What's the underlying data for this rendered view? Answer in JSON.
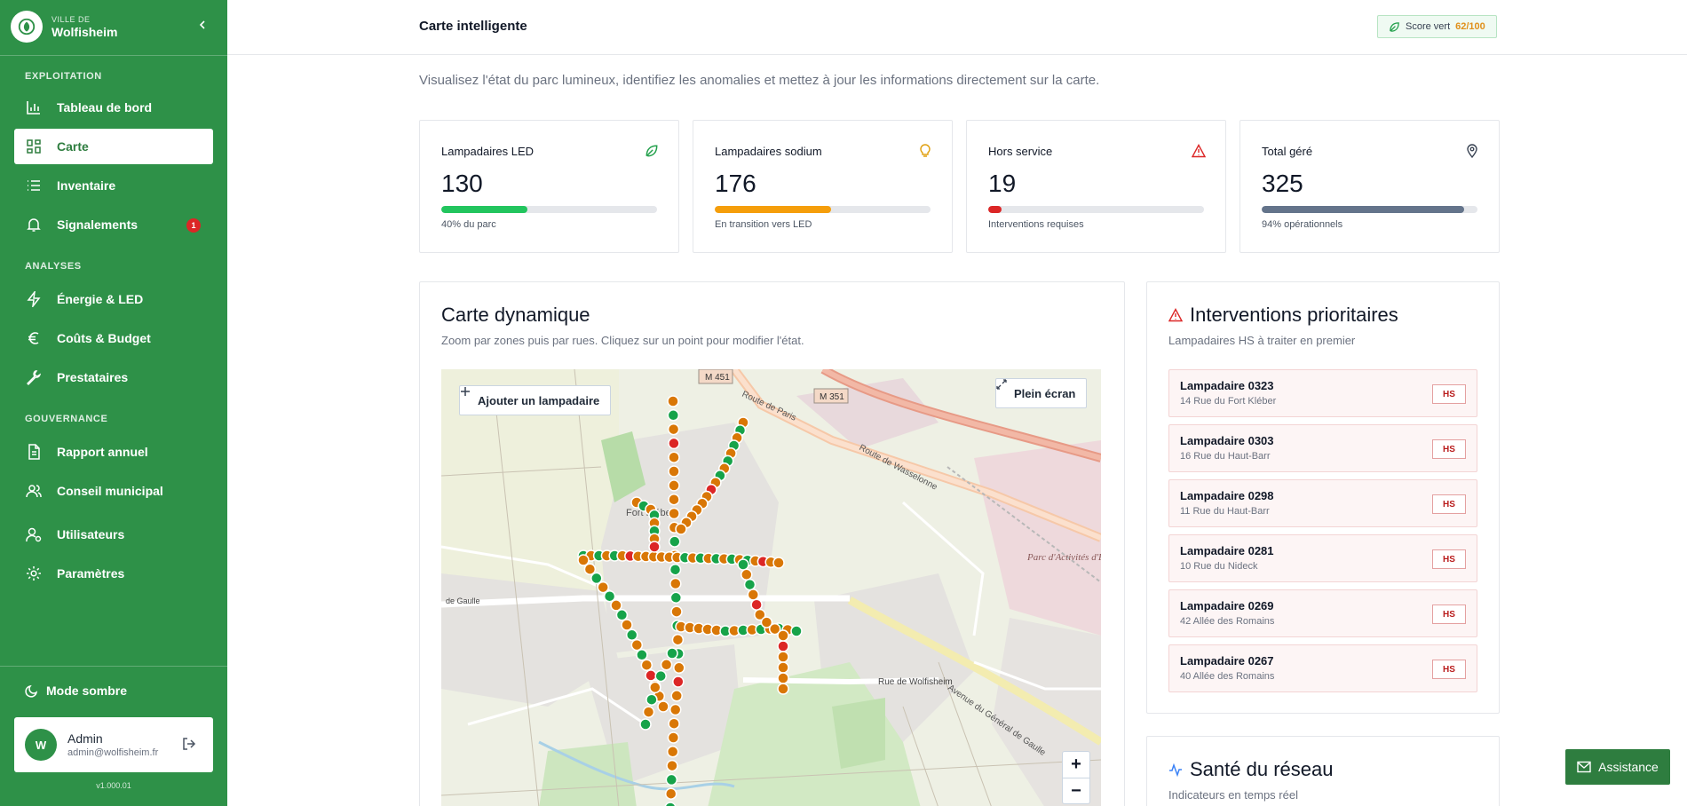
{
  "brand": {
    "sub": "VILLE DE",
    "name": "Wolfisheim"
  },
  "sidebar": {
    "sections": [
      "EXPLOITATION",
      "ANALYSES",
      "GOUVERNANCE"
    ],
    "items": [
      {
        "label": "Tableau de bord",
        "icon": "bar-chart-icon"
      },
      {
        "label": "Carte",
        "icon": "grid-icon"
      },
      {
        "label": "Inventaire",
        "icon": "list-icon"
      },
      {
        "label": "Signalements",
        "icon": "bell-icon",
        "badge": "1"
      },
      {
        "label": "Énergie & LED",
        "icon": "zap-icon"
      },
      {
        "label": "Coûts & Budget",
        "icon": "euro-icon"
      },
      {
        "label": "Prestataires",
        "icon": "wrench-icon"
      },
      {
        "label": "Rapport annuel",
        "icon": "file-icon"
      },
      {
        "label": "Conseil municipal",
        "icon": "users-icon"
      },
      {
        "label": "Utilisateurs",
        "icon": "user-cog-icon"
      },
      {
        "label": "Paramètres",
        "icon": "gear-icon"
      }
    ],
    "dark_mode": "Mode sombre",
    "user": {
      "initial": "W",
      "name": "Admin",
      "email": "admin@wolfisheim.fr"
    },
    "version": "v1.000.01"
  },
  "header": {
    "title": "Carte intelligente",
    "score_label": "Score vert",
    "score_value": "62/100"
  },
  "subtitle": "Visualisez l'état du parc lumineux, identifiez les anomalies et mettez à jour les informations directement sur la carte.",
  "stats": [
    {
      "label": "Lampadaires LED",
      "value": "130",
      "note": "40% du parc",
      "progress": 0.4,
      "color": "#22c55e",
      "icon": "leaf-icon"
    },
    {
      "label": "Lampadaires sodium",
      "value": "176",
      "note": "En transition vers LED",
      "progress": 0.54,
      "color": "#f59e0b",
      "icon": "bulb-icon"
    },
    {
      "label": "Hors service",
      "value": "19",
      "note": "Interventions requises",
      "progress": 0.06,
      "color": "#dc2626",
      "icon": "warning-icon"
    },
    {
      "label": "Total géré",
      "value": "325",
      "note": "94% opérationnels",
      "progress": 0.94,
      "color": "#64748b",
      "icon": "pin-icon"
    }
  ],
  "map_panel": {
    "title": "Carte dynamique",
    "subtitle": "Zoom par zones puis par rues. Cliquez sur un point pour modifier l'état.",
    "add_button": "Ajouter un lampadaire",
    "fullscreen_button": "Plein écran",
    "zoom_in": "+",
    "zoom_out": "−",
    "labels": {
      "m451": "M 451",
      "m351": "M 351",
      "route_paris": "Route de Paris",
      "route_wasselonne": "Route de Wasselonne",
      "fort_kleber": "Fort Kléber",
      "rue_wolfisheim": "Rue de Wolfisheim",
      "avenue_gaulle": "Avenue du Général de Gaulle",
      "parc": "Parc d'Activités d'Eckbolsheim",
      "de_gaulle": "de Gaulle"
    },
    "colors": {
      "led": "#16a34a",
      "sodium": "#d97706",
      "hs": "#dc2626"
    }
  },
  "interventions": {
    "title": "Interventions prioritaires",
    "subtitle": "Lampadaires HS à traiter en premier",
    "badge": "HS",
    "items": [
      {
        "name": "Lampadaire 0323",
        "address": "14 Rue du Fort Kléber"
      },
      {
        "name": "Lampadaire 0303",
        "address": "16 Rue du Haut-Barr"
      },
      {
        "name": "Lampadaire 0298",
        "address": "11 Rue du Haut-Barr"
      },
      {
        "name": "Lampadaire 0281",
        "address": "10 Rue du Nideck"
      },
      {
        "name": "Lampadaire 0269",
        "address": "42 Allée des Romains"
      },
      {
        "name": "Lampadaire 0267",
        "address": "40 Allée des Romains"
      }
    ]
  },
  "health": {
    "title": "Santé du réseau",
    "subtitle": "Indicateurs en temps réel"
  },
  "assistance": "Assistance"
}
